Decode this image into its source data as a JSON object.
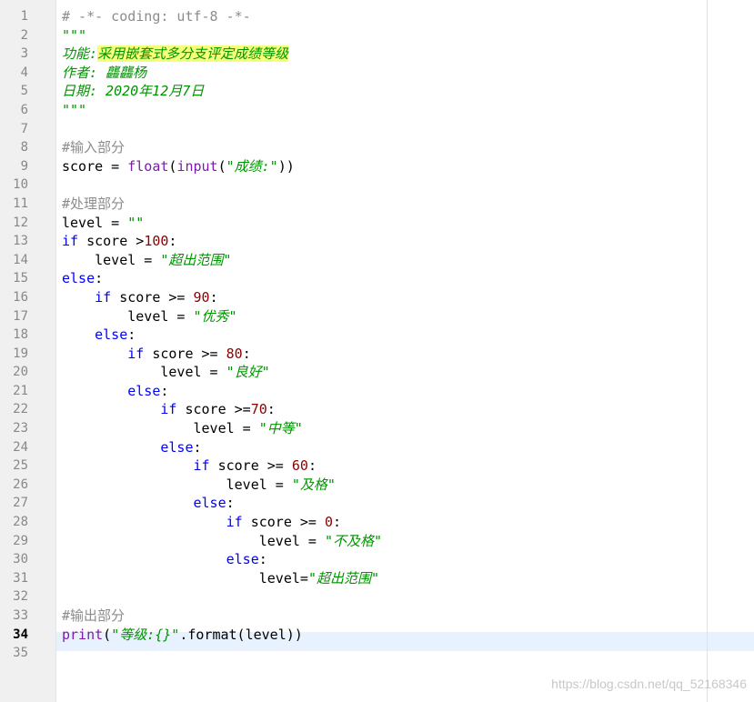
{
  "editor": {
    "active_line": 34,
    "lines": [
      {
        "n": "1",
        "t": [
          [
            "cm",
            "# -*- coding: utf-8 -*-"
          ]
        ]
      },
      {
        "n": "2",
        "t": [
          [
            "str",
            "\"\"\""
          ]
        ]
      },
      {
        "n": "3",
        "t": [
          [
            "str",
            "功能:"
          ],
          [
            "strhl",
            "采用嵌套式多分支评定成绩等级"
          ]
        ]
      },
      {
        "n": "4",
        "t": [
          [
            "str",
            "作者: 龘龘杨"
          ]
        ]
      },
      {
        "n": "5",
        "t": [
          [
            "str",
            "日期: 2020年12月7日"
          ]
        ]
      },
      {
        "n": "6",
        "t": [
          [
            "str",
            "\"\"\""
          ]
        ]
      },
      {
        "n": "7",
        "t": []
      },
      {
        "n": "8",
        "t": [
          [
            "cm",
            "#输入部分"
          ]
        ]
      },
      {
        "n": "9",
        "t": [
          [
            "p",
            "score = "
          ],
          [
            "bi",
            "float"
          ],
          [
            "p",
            "("
          ],
          [
            "bi",
            "input"
          ],
          [
            "p",
            "("
          ],
          [
            "str",
            "\"成绩:\""
          ],
          [
            "p",
            "))"
          ]
        ]
      },
      {
        "n": "10",
        "t": []
      },
      {
        "n": "11",
        "t": [
          [
            "cm",
            "#处理部分"
          ]
        ]
      },
      {
        "n": "12",
        "t": [
          [
            "p",
            "level = "
          ],
          [
            "str",
            "\"\""
          ]
        ]
      },
      {
        "n": "13",
        "t": [
          [
            "kw",
            "if"
          ],
          [
            "p",
            " score >"
          ],
          [
            "num",
            "100"
          ],
          [
            "p",
            ":"
          ]
        ]
      },
      {
        "n": "14",
        "t": [
          [
            "p",
            "    level = "
          ],
          [
            "str",
            "\"超出范围\""
          ]
        ]
      },
      {
        "n": "15",
        "t": [
          [
            "kw",
            "else"
          ],
          [
            "p",
            ":"
          ]
        ]
      },
      {
        "n": "16",
        "t": [
          [
            "p",
            "    "
          ],
          [
            "kw",
            "if"
          ],
          [
            "p",
            " score >= "
          ],
          [
            "num",
            "90"
          ],
          [
            "p",
            ":"
          ]
        ]
      },
      {
        "n": "17",
        "t": [
          [
            "p",
            "        level = "
          ],
          [
            "str",
            "\"优秀\""
          ]
        ]
      },
      {
        "n": "18",
        "t": [
          [
            "p",
            "    "
          ],
          [
            "kw",
            "else"
          ],
          [
            "p",
            ":"
          ]
        ]
      },
      {
        "n": "19",
        "t": [
          [
            "p",
            "        "
          ],
          [
            "kw",
            "if"
          ],
          [
            "p",
            " score >= "
          ],
          [
            "num",
            "80"
          ],
          [
            "p",
            ":"
          ]
        ]
      },
      {
        "n": "20",
        "t": [
          [
            "p",
            "            level = "
          ],
          [
            "str",
            "\"良好\""
          ]
        ]
      },
      {
        "n": "21",
        "t": [
          [
            "p",
            "        "
          ],
          [
            "kw",
            "else"
          ],
          [
            "p",
            ":"
          ]
        ]
      },
      {
        "n": "22",
        "t": [
          [
            "p",
            "            "
          ],
          [
            "kw",
            "if"
          ],
          [
            "p",
            " score >="
          ],
          [
            "num",
            "70"
          ],
          [
            "p",
            ":"
          ]
        ]
      },
      {
        "n": "23",
        "t": [
          [
            "p",
            "                level = "
          ],
          [
            "str",
            "\"中等\""
          ]
        ]
      },
      {
        "n": "24",
        "t": [
          [
            "p",
            "            "
          ],
          [
            "kw",
            "else"
          ],
          [
            "p",
            ":"
          ]
        ]
      },
      {
        "n": "25",
        "t": [
          [
            "p",
            "                "
          ],
          [
            "kw",
            "if"
          ],
          [
            "p",
            " score >= "
          ],
          [
            "num",
            "60"
          ],
          [
            "p",
            ":"
          ]
        ]
      },
      {
        "n": "26",
        "t": [
          [
            "p",
            "                    level = "
          ],
          [
            "str",
            "\"及格\""
          ]
        ]
      },
      {
        "n": "27",
        "t": [
          [
            "p",
            "                "
          ],
          [
            "kw",
            "else"
          ],
          [
            "p",
            ":"
          ]
        ]
      },
      {
        "n": "28",
        "t": [
          [
            "p",
            "                    "
          ],
          [
            "kw",
            "if"
          ],
          [
            "p",
            " score >= "
          ],
          [
            "num",
            "0"
          ],
          [
            "p",
            ":"
          ]
        ]
      },
      {
        "n": "29",
        "t": [
          [
            "p",
            "                        level = "
          ],
          [
            "str",
            "\"不及格\""
          ]
        ]
      },
      {
        "n": "30",
        "t": [
          [
            "p",
            "                    "
          ],
          [
            "kw",
            "else"
          ],
          [
            "p",
            ":"
          ]
        ]
      },
      {
        "n": "31",
        "t": [
          [
            "p",
            "                        level="
          ],
          [
            "str",
            "\"超出范围\""
          ]
        ]
      },
      {
        "n": "32",
        "t": []
      },
      {
        "n": "33",
        "t": [
          [
            "cm",
            "#输出部分"
          ]
        ]
      },
      {
        "n": "34",
        "t": [
          [
            "bi",
            "print"
          ],
          [
            "p",
            "("
          ],
          [
            "str",
            "\"等级:{}\""
          ],
          [
            "p",
            ".format(level))"
          ]
        ]
      },
      {
        "n": "35",
        "t": []
      }
    ]
  },
  "watermark": "https://blog.csdn.net/qq_52168346",
  "colors": {
    "keyword": "#0000ff",
    "builtin": "#7c1bab",
    "string": "#009400",
    "number": "#8b0000",
    "comment": "#8c8c8c",
    "highlight": "#f5ff7a",
    "current_line": "#e8f2fe"
  }
}
